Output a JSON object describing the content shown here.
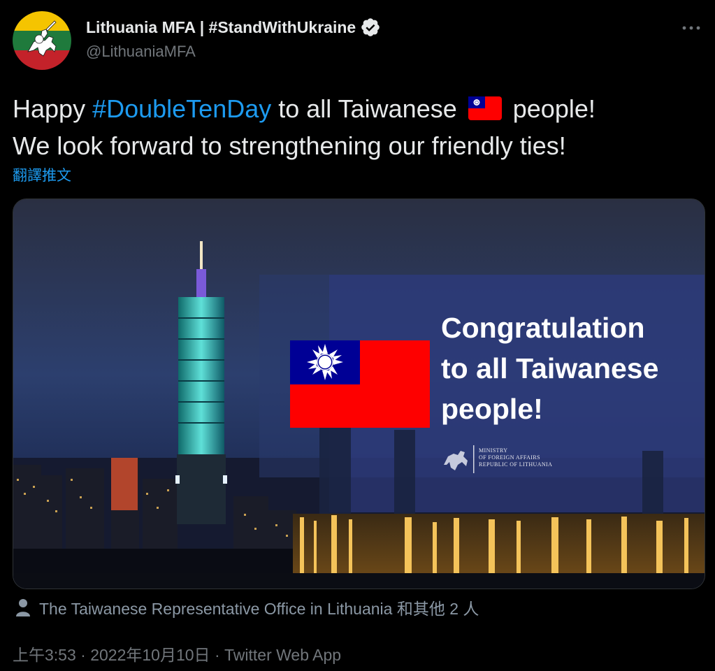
{
  "author": {
    "display_name": "Lithuania MFA | #StandWithUkraine",
    "handle": "@LithuaniaMFA",
    "avatar_icon": "vytis-knight-icon",
    "verified_icon": "verified-badge-icon",
    "more_icon": "more-options-icon"
  },
  "tweet": {
    "text_before_hashtag": "Happy ",
    "hashtag": "#DoubleTenDay",
    "text_after_hashtag": " to all Taiwanese ",
    "flag_emoji": "taiwan-flag-emoji",
    "text_line1_end": " people!",
    "text_line2": "We look forward to strengthening our friendly ties!",
    "translate_label": "翻譯推文"
  },
  "media": {
    "headline": "Congratulation\nto all Taiwanese\npeople!",
    "ministry_line1": "MINISTRY",
    "ministry_line2": "OF FOREIGN AFFAIRS",
    "ministry_line3": "REPUBLIC OF LITHUANIA",
    "flag": "taiwan-flag",
    "background": "taipei-night-skyline"
  },
  "tagged": {
    "icon": "person-icon",
    "text": "The Taiwanese Representative Office in Lithuania 和其他 2 人"
  },
  "meta": {
    "time": "上午3:53",
    "date": "2022年10月10日",
    "source": "Twitter Web App",
    "separator": " · "
  },
  "colors": {
    "accent": "#1d9bf0",
    "flag_red": "#fe0000",
    "flag_blue": "#000095",
    "background": "#000000"
  }
}
